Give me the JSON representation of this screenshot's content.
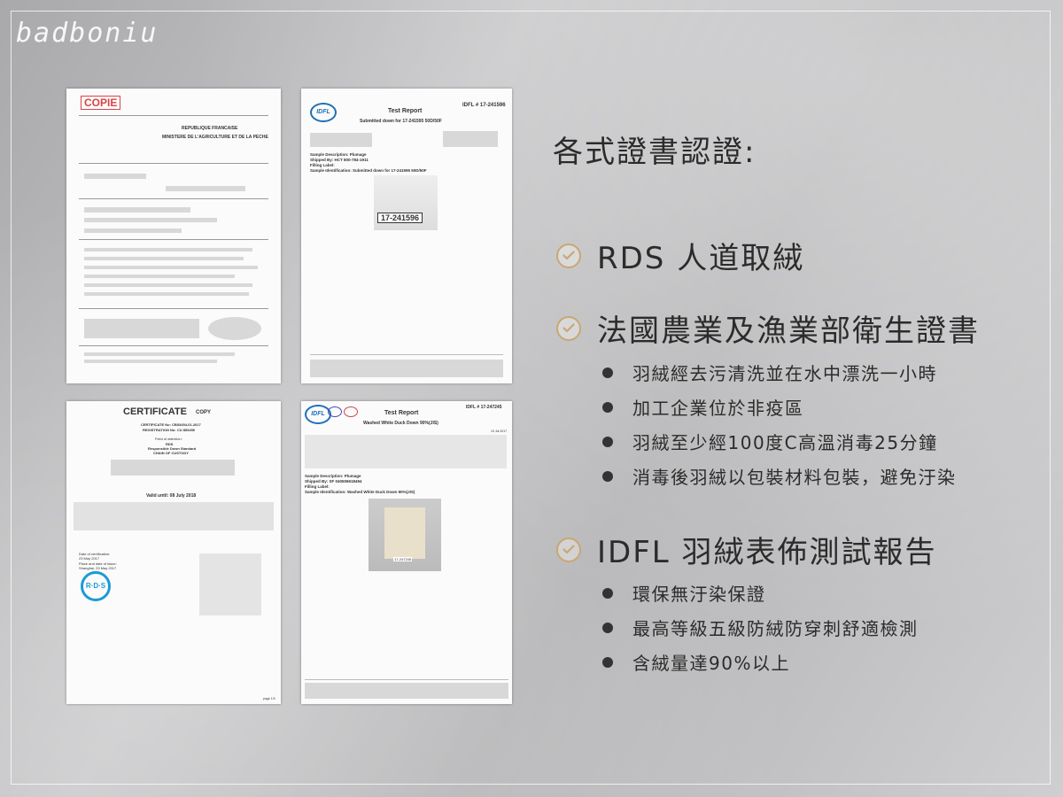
{
  "brand": "badboniu",
  "docs": {
    "doc1": {
      "stamp": "COPIE",
      "heading": "MINISTERE DE L'AGRICULTURE ET DE LA PECHE",
      "sub": "REPUBLIQUE FRANCAISE"
    },
    "doc2": {
      "report": "Test Report",
      "id": "IDFL # 17-241596",
      "submitted": "Submitted down for 17-241595 50D/50F",
      "sample_label": "17-241596",
      "logo": "IDFL",
      "desc_line1": "Sample Description: Plumage",
      "desc_line2": "Shipped By: HCT 800-784-1911",
      "desc_line3": "Filling Label:",
      "desc_line4": "Sample Identification: Submitted down for 17-241595 50D/50F"
    },
    "doc3": {
      "title": "CERTIFICATE",
      "copy": "COPY",
      "certno": "CERTIFICATE No: CB53454-01.2017",
      "regno": "REGISTRATION No: CU 853456",
      "field": "Field of attention:",
      "standard": "RDS",
      "standard_full": "Responsible Down Standard",
      "chain": "CHAIN OF CUSTODY",
      "valid": "Valid until: 08 July 2018",
      "date1": "Date of certification:",
      "date1v": "23 May 2017",
      "place": "Place and date of issue:",
      "placev": "Shanghai, 23 May 2017",
      "page": "page 1/3",
      "rds": "R·D·S"
    },
    "doc4": {
      "report": "Test Report",
      "id": "IDFL # 17-247245",
      "product": "Washed White Duck Down 90%(JIS)",
      "logo": "IDFL",
      "date": "19 Jul 2017",
      "desc_line1": "Sample Description: Plumage",
      "desc_line2": "Shipped By: SF 040506618494",
      "desc_line3": "Filling Label:",
      "desc_line4": "Sample Identification: Washed White Duck Down 90%(JIS)",
      "sample_label": "17-247245"
    }
  },
  "panel": {
    "title": "各式證書認證:",
    "sections": [
      {
        "label": "RDS 人道取絨"
      },
      {
        "label": "法國農業及漁業部衛生證書"
      },
      {
        "label": "IDFL 羽絨表佈測試報告"
      }
    ],
    "bullets_france": [
      "羽絨經去污清洗並在水中漂洗一小時",
      "加工企業位於非疫區",
      "羽絨至少經100度C高溫消毒25分鐘",
      "消毒後羽絨以包裝材料包裝，避免汙染"
    ],
    "bullets_idfl": [
      "環保無汙染保證",
      "最高等級五級防絨防穿刺舒適檢測",
      "含絨量達90%以上"
    ],
    "accent_color": "#c9a772"
  }
}
